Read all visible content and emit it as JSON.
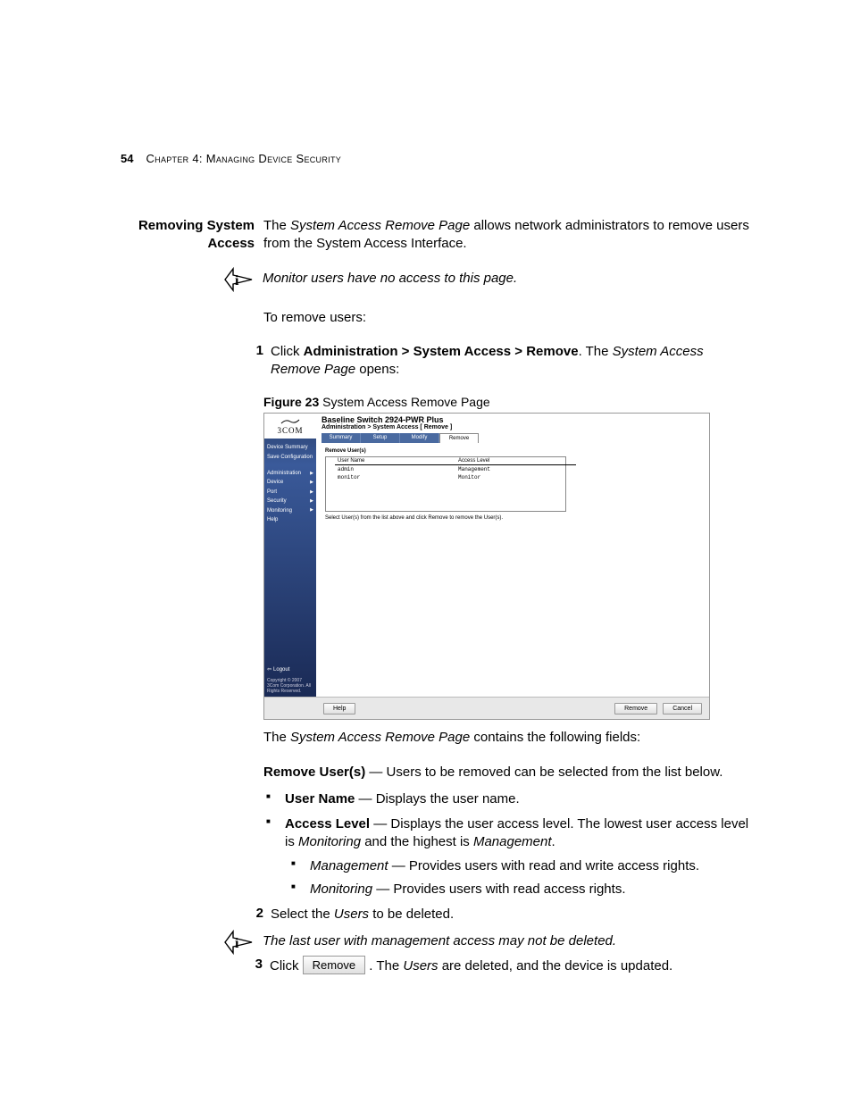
{
  "page_number": "54",
  "chapter_label": "Chapter 4: Managing Device Security",
  "section_heading_line1": "Removing System",
  "section_heading_line2": "Access",
  "intro_part1": "The ",
  "intro_italic": "System Access Remove Page",
  "intro_part2": " allows network administrators to remove users from the System Access Interface.",
  "note1": "Monitor users have no access to this page.",
  "to_remove": "To remove users:",
  "step1_a": "Click ",
  "step1_bold": "Administration > System Access > Remove",
  "step1_b": ". The ",
  "step1_italic": "System Access Remove Page",
  "step1_c": " opens:",
  "figure_label": "Figure 23",
  "figure_caption": "   System Access Remove Page",
  "figure": {
    "brand": "3COM",
    "product_title": "Baseline Switch 2924-PWR Plus",
    "breadcrumb": "Administration > System Access [ Remove ]",
    "side": {
      "device_summary": "Device Summary",
      "save_config": "Save Configuration",
      "admin": "Administration",
      "device": "Device",
      "port": "Port",
      "security": "Security",
      "monitoring": "Monitoring",
      "help": "Help",
      "logout": "Logout",
      "copyright": "Copyright © 2007 3Com Corporation. All Rights Reserved."
    },
    "tabs": [
      "Summary",
      "Setup",
      "Modify",
      "Remove"
    ],
    "panel_label": "Remove User(s)",
    "table": {
      "headers": [
        "User Name",
        "Access Level"
      ],
      "rows": [
        [
          "admin",
          "Management"
        ],
        [
          "monitor",
          "Monitor"
        ]
      ]
    },
    "table_note": "Select User(s) from the list above and click Remove to remove the User(s).",
    "buttons": {
      "help": "Help",
      "remove": "Remove",
      "cancel": "Cancel"
    }
  },
  "after_fig_a": "The ",
  "after_fig_italic": "System Access Remove Page",
  "after_fig_b": " contains the following fields:",
  "remove_users_bold": "Remove User(s)",
  "remove_users_rest": " — Users to be removed can be selected from the list below.",
  "bullet_user_name_bold": "User Name",
  "bullet_user_name_rest": " — Displays the user name.",
  "bullet_access_bold": "Access Level",
  "bullet_access_rest": " — Displays the user access level. The lowest user access level is ",
  "bullet_access_i1": "Monitoring",
  "bullet_access_mid": " and the highest is ",
  "bullet_access_i2": "Management",
  "bullet_access_end": ".",
  "sub_mgmt_i": "Management",
  "sub_mgmt_rest": " — Provides users with read and write access rights.",
  "sub_mon_i": "Monitoring",
  "sub_mon_rest": " — Provides users with read access rights.",
  "step2_a": "Select the ",
  "step2_i": "Users",
  "step2_b": " to be deleted.",
  "note2": "The last user with management access may not be deleted.",
  "step3_a": "Click ",
  "step3_btn": "Remove",
  "step3_b": ". The ",
  "step3_i": "Users",
  "step3_c": " are deleted, and the device is updated."
}
